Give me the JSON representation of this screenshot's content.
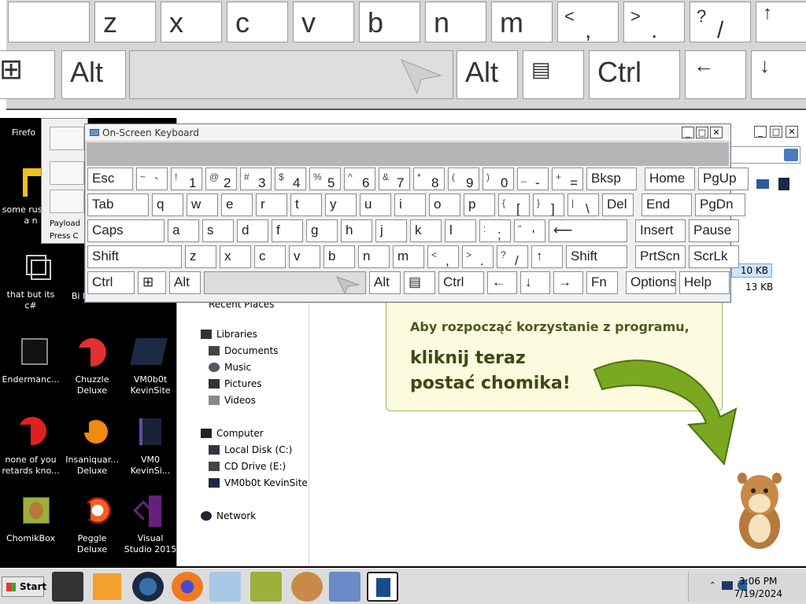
{
  "big_keyboard": {
    "row1": [
      "z",
      "x",
      "c",
      "v",
      "b",
      "n",
      "m"
    ],
    "row1_symbols": [
      {
        "top": "<",
        "bottom": ","
      },
      {
        "top": ">",
        "bottom": "."
      },
      {
        "top": "?",
        "bottom": "/"
      },
      {
        "top": "↑",
        "bottom": ""
      }
    ],
    "row2": {
      "win": "⊞",
      "alt_left": "Alt",
      "alt_right": "Alt",
      "menu": "▤",
      "ctrl": "Ctrl",
      "left": "←",
      "down": "↓"
    }
  },
  "osk": {
    "title": "On-Screen Keyboard",
    "min": "_",
    "max": "□",
    "close": "✕",
    "rows": [
      [
        {
          "l": "Esc"
        },
        {
          "s": "~",
          "b": "`"
        },
        {
          "s": "!",
          "b": "1"
        },
        {
          "s": "@",
          "b": "2"
        },
        {
          "s": "#",
          "b": "3"
        },
        {
          "s": "$",
          "b": "4"
        },
        {
          "s": "%",
          "b": "5"
        },
        {
          "s": "^",
          "b": "6"
        },
        {
          "s": "&",
          "b": "7"
        },
        {
          "s": "*",
          "b": "8"
        },
        {
          "s": "(",
          "b": "9"
        },
        {
          "s": ")",
          "b": "0"
        },
        {
          "s": "_",
          "b": "-"
        },
        {
          "s": "+",
          "b": "="
        },
        {
          "l": "Bksp"
        },
        {
          "l": "Home"
        },
        {
          "l": "PgUp"
        }
      ],
      [
        {
          "l": "Tab"
        },
        {
          "l": "q"
        },
        {
          "l": "w"
        },
        {
          "l": "e"
        },
        {
          "l": "r"
        },
        {
          "l": "t"
        },
        {
          "l": "y"
        },
        {
          "l": "u"
        },
        {
          "l": "i"
        },
        {
          "l": "o"
        },
        {
          "l": "p"
        },
        {
          "s": "{",
          "b": "["
        },
        {
          "s": "}",
          "b": "]"
        },
        {
          "s": "|",
          "b": "\\"
        },
        {
          "l": "Del"
        },
        {
          "l": "End"
        },
        {
          "l": "PgDn"
        }
      ],
      [
        {
          "l": "Caps"
        },
        {
          "l": "a"
        },
        {
          "l": "s"
        },
        {
          "l": "d"
        },
        {
          "l": "f"
        },
        {
          "l": "g"
        },
        {
          "l": "h"
        },
        {
          "l": "j"
        },
        {
          "l": "k"
        },
        {
          "l": "l"
        },
        {
          "s": ":",
          "b": ";"
        },
        {
          "s": "\"",
          "b": "'"
        },
        {
          "l": "⟵"
        },
        {
          "l": "Insert"
        },
        {
          "l": "Pause"
        }
      ],
      [
        {
          "l": "Shift"
        },
        {
          "l": "z"
        },
        {
          "l": "x"
        },
        {
          "l": "c"
        },
        {
          "l": "v"
        },
        {
          "l": "b"
        },
        {
          "l": "n"
        },
        {
          "l": "m"
        },
        {
          "s": "<",
          "b": ","
        },
        {
          "s": ">",
          "b": "."
        },
        {
          "s": "?",
          "b": "/"
        },
        {
          "l": "↑"
        },
        {
          "l": "Shift"
        },
        {
          "l": "PrtScn"
        },
        {
          "l": "ScrLk"
        }
      ],
      [
        {
          "l": "Ctrl"
        },
        {
          "l": "⊞"
        },
        {
          "l": "Alt"
        },
        {
          "l": ""
        },
        {
          "l": "Alt"
        },
        {
          "l": "▤"
        },
        {
          "l": "Ctrl"
        },
        {
          "l": "←"
        },
        {
          "l": "↓"
        },
        {
          "l": "→"
        },
        {
          "l": "Fn"
        },
        {
          "l": "Options"
        },
        {
          "l": "Help"
        }
      ]
    ]
  },
  "desktop_icons": [
    {
      "label": "Firefo",
      "name": "firefox"
    },
    {
      "label": "some rus ran a n",
      "name": "some-rus"
    },
    {
      "label": "that but its c#",
      "name": "that-but-its"
    },
    {
      "label": "Bi Deluxe",
      "name": "bi-deluxe"
    },
    {
      "label": "Endermanc...",
      "name": "endermanc"
    },
    {
      "label": "Chuzzle Deluxe",
      "name": "chuzzle"
    },
    {
      "label": "VM0b0t KevinSite",
      "name": "vm0b0t-kevinsite"
    },
    {
      "label": "none of you retards kno...",
      "name": "none-of-you"
    },
    {
      "label": "Insaniquar... Deluxe",
      "name": "insaniquarium"
    },
    {
      "label": "VM0 KevinSi...",
      "name": "vm0-kevinsite"
    },
    {
      "label": "ChomikBox",
      "name": "chomikbox"
    },
    {
      "label": "Peggle Deluxe",
      "name": "peggle"
    },
    {
      "label": "Visual Studio 2015",
      "name": "visual-studio"
    }
  ],
  "partial_window": {
    "line1": "Payload",
    "line2": "Press C"
  },
  "explorer": {
    "recent": "Recent Places",
    "libraries": "Libraries",
    "documents": "Documents",
    "music": "Music",
    "pictures": "Pictures",
    "videos": "Videos",
    "computer": "Computer",
    "local_disk": "Local Disk (C:)",
    "cd_drive": "CD Drive (E:)",
    "vm0b0t": "VM0b0t KevinSite",
    "network": "Network",
    "sizes": [
      "10 KB",
      "13 KB"
    ]
  },
  "promo": {
    "line1": "Aby rozpocząć korzystanie z programu,",
    "line2": "kliknij teraz",
    "line3": "postać chomika!"
  },
  "taskbar": {
    "start": "Start",
    "time": "3:06 PM",
    "date": "7/19/2024"
  }
}
